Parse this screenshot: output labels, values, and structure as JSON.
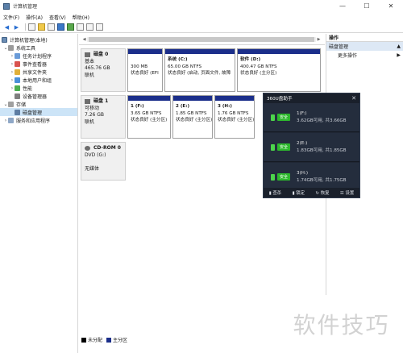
{
  "window": {
    "title": "计算机管理",
    "minimize": "—",
    "maximize": "☐",
    "close": "✕"
  },
  "menu": [
    "文件(F)",
    "操作(A)",
    "查看(V)",
    "帮助(H)"
  ],
  "tree": {
    "root": "计算机管理(本地)",
    "system_tools": "系统工具",
    "task_scheduler": "任务计划程序",
    "event_viewer": "事件查看器",
    "shared_folders": "共享文件夹",
    "local_users": "本地用户和组",
    "performance": "性能",
    "device_manager": "设备管理器",
    "storage": "存储",
    "disk_management": "磁盘管理",
    "services": "服务和应用程序"
  },
  "disks": [
    {
      "name": "磁盘 0",
      "type": "基本",
      "size": "465.76 GB",
      "status": "联机",
      "partitions": [
        {
          "name": "",
          "size": "300 MB",
          "status": "状态良好 (EFI"
        },
        {
          "name": "系统 (C:)",
          "size": "65.00 GB NTFS",
          "status": "状态良好 (启动, 页面文件, 故障"
        },
        {
          "name": "软件 (D:)",
          "size": "400.47 GB NTFS",
          "status": "状态良好 (主分区)"
        }
      ]
    },
    {
      "name": "磁盘 1",
      "type": "可移动",
      "size": "7.26 GB",
      "status": "联机",
      "partitions": [
        {
          "name": "1 (F:)",
          "size": "3.65 GB NTFS",
          "status": "状态良好 (主分区)"
        },
        {
          "name": "2 (E:)",
          "size": "1.85 GB NTFS",
          "status": "状态良好 (主分区)"
        },
        {
          "name": "3 (H:)",
          "size": "1.76 GB NTFS",
          "status": "状态良好 (主分区)"
        }
      ]
    }
  ],
  "cdrom": {
    "name": "CD-ROM 0",
    "type": "DVD (G:)",
    "status": "无媒体"
  },
  "legend": {
    "unallocated": "未分配",
    "primary": "主分区"
  },
  "actions": {
    "header": "操作",
    "section": "磁盘管理",
    "more": "更多操作"
  },
  "popup": {
    "title": "360U盘助手",
    "safe_label": "安全",
    "drives": [
      {
        "label": "1(F:)",
        "space": "3.62GB可用, 共3.66GB"
      },
      {
        "label": "2(E:)",
        "space": "1.83GB可用, 共1.85GB"
      },
      {
        "label": "3(H:)",
        "space": "1.74GB可用, 共1.75GB"
      }
    ],
    "footer": [
      "▮ 查杀",
      "▮ 锁定",
      "↻ 恢复",
      "☰ 设置"
    ]
  },
  "watermark": "软件技巧",
  "colors": {
    "primary_partition": "#1b2e8a",
    "unallocated": "#000000",
    "safe_green": "#2db82d",
    "popup_bg": "#1f2633"
  }
}
